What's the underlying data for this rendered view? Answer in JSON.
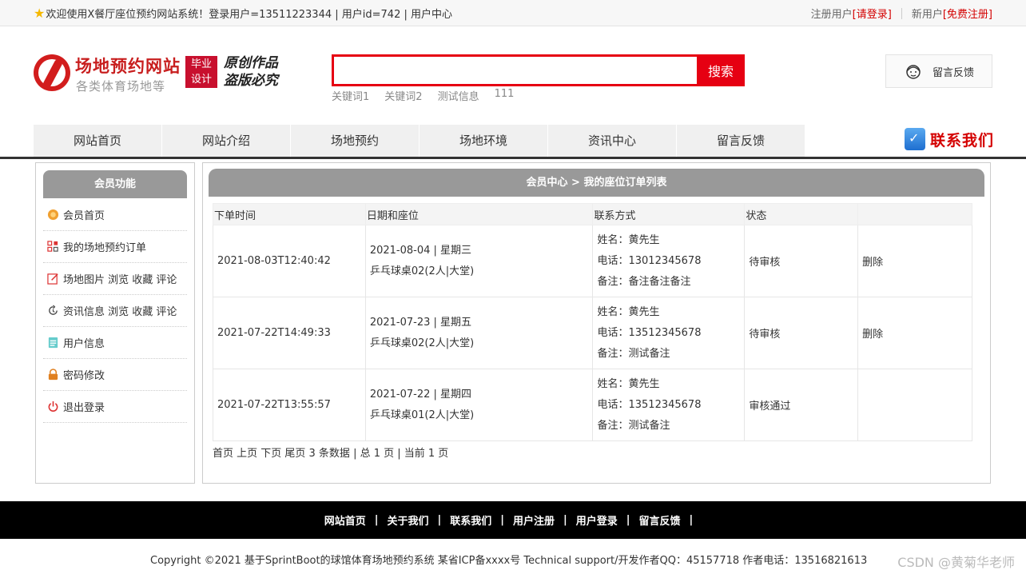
{
  "topbar": {
    "welcome": "欢迎使用X餐厅座位预约网站系统！登录用户=13511223344 | 用户id=742 | 用户中心",
    "register_prefix": "注册用户",
    "login_link": "[请登录]",
    "newuser_prefix": "新用户",
    "signup_link": "[免费注册]"
  },
  "header": {
    "site_title": "场地预约网站",
    "site_subtitle": "各类体育场地等",
    "badge_line1": "毕业",
    "badge_line2": "设计",
    "slogan_line1": "原创作品",
    "slogan_line2": "盗版必究",
    "search_placeholder": "",
    "search_button": "搜索",
    "hot_words": [
      "关键词1",
      "关键词2",
      "测试信息",
      "111"
    ],
    "feedback_label": "留言反馈"
  },
  "nav": {
    "items": [
      "网站首页",
      "网站介绍",
      "场地预约",
      "场地环境",
      "资讯中心",
      "留言反馈"
    ],
    "contact_label": "联系我们"
  },
  "sidebar": {
    "title": "会员功能",
    "items": [
      {
        "label": "会员首页",
        "icon": "member-home-icon"
      },
      {
        "label": "我的场地预约订单",
        "icon": "orders-icon"
      },
      {
        "label": "场地图片 浏览 收藏 评论",
        "icon": "edit-icon"
      },
      {
        "label": "资讯信息 浏览 收藏 评论",
        "icon": "refresh-icon"
      },
      {
        "label": "用户信息",
        "icon": "user-info-icon"
      },
      {
        "label": "密码修改",
        "icon": "lock-icon"
      },
      {
        "label": "退出登录",
        "icon": "power-icon"
      }
    ]
  },
  "main": {
    "title": "会员中心 > 我的座位订单列表",
    "columns": [
      "下单时间",
      "日期和座位",
      "联系方式",
      "状态",
      ""
    ],
    "rows": [
      {
        "order_time": "2021-08-03T12:40:42",
        "date_line": "2021-08-04 | 星期三",
        "seat_line": "乒乓球桌02(2人|大堂)",
        "name_line": "姓名：黄先生",
        "phone_line": "电话：13012345678",
        "note_line": "备注：备注备注备注",
        "status": "待审核",
        "status_pending": true,
        "action": "删除"
      },
      {
        "order_time": "2021-07-22T14:49:33",
        "date_line": "2021-07-23 | 星期五",
        "seat_line": "乒乓球桌02(2人|大堂)",
        "name_line": "姓名：黄先生",
        "phone_line": "电话：13512345678",
        "note_line": "备注：测试备注",
        "status": "待审核",
        "status_pending": true,
        "action": "删除"
      },
      {
        "order_time": "2021-07-22T13:55:57",
        "date_line": "2021-07-22 | 星期四",
        "seat_line": "乒乓球桌01(2人|大堂)",
        "name_line": "姓名：黄先生",
        "phone_line": "电话：13512345678",
        "note_line": "备注：测试备注",
        "status": "审核通过",
        "status_pending": false,
        "action": ""
      }
    ],
    "pager": "首页 上页 下页 尾页 3 条数据 | 总 1 页 | 当前 1 页"
  },
  "footer": {
    "links": [
      "网站首页",
      "关于我们",
      "联系我们",
      "用户注册",
      "用户登录",
      "留言反馈"
    ],
    "copyright": "Copyright ©2021 基于SprintBoot的球馆体育场地预约系统   某省ICP备xxxx号   Technical support/开发作者QQ：45157718   作者电话：13516821613",
    "watermark": "CSDN @黄菊华老师"
  },
  "colors": {
    "brand_red": "#e60012",
    "pending_red": "#d40000",
    "header_gray": "#999999"
  }
}
